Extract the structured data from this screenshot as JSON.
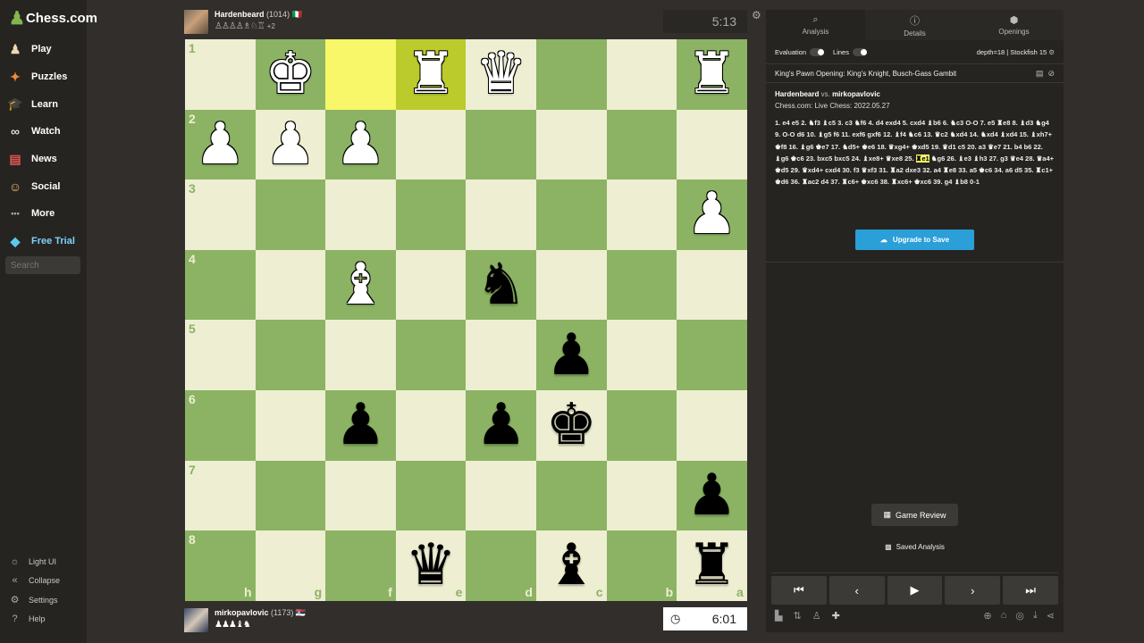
{
  "app": {
    "logo_text": "Chess.com"
  },
  "sidebar": {
    "items": [
      {
        "label": "Play",
        "icon": "pawn-icon"
      },
      {
        "label": "Puzzles",
        "icon": "puzzle-icon"
      },
      {
        "label": "Learn",
        "icon": "graduation-cap-icon"
      },
      {
        "label": "Watch",
        "icon": "binoculars-icon"
      },
      {
        "label": "News",
        "icon": "newspaper-icon"
      },
      {
        "label": "Social",
        "icon": "people-icon"
      },
      {
        "label": "More",
        "icon": "dots-icon"
      },
      {
        "label": "Free Trial",
        "icon": "diamond-icon"
      }
    ],
    "search_placeholder": "Search",
    "bottom_items": [
      {
        "label": "Light UI",
        "icon": "sun-icon"
      },
      {
        "label": "Collapse",
        "icon": "collapse-icon"
      },
      {
        "label": "Settings",
        "icon": "gear-icon"
      },
      {
        "label": "Help",
        "icon": "help-icon"
      }
    ]
  },
  "top_player": {
    "name": "Hardenbeard",
    "rating": "(1014)",
    "flag": "🇮🇹",
    "captured": "♙♙♙♙♗♘♖",
    "advantage": "+2",
    "clock": "5:13"
  },
  "bottom_player": {
    "name": "mirkopavlovic",
    "rating": "(1173)",
    "flag": "🇷🇸",
    "captured": "♟♟♟♝♞",
    "clock": "6:01"
  },
  "board": {
    "ranks": [
      "1",
      "2",
      "3",
      "4",
      "5",
      "6",
      "7",
      "8"
    ],
    "files": [
      "h",
      "g",
      "f",
      "e",
      "d",
      "c",
      "b",
      "a"
    ],
    "pieces": [
      {
        "sq": "g1",
        "glyph": "♚",
        "color": "w"
      },
      {
        "sq": "e1",
        "glyph": "♜",
        "color": "w"
      },
      {
        "sq": "d1",
        "glyph": "♛",
        "color": "w"
      },
      {
        "sq": "a1",
        "glyph": "♜",
        "color": "w"
      },
      {
        "sq": "h2",
        "glyph": "♟",
        "color": "w"
      },
      {
        "sq": "g2",
        "glyph": "♟",
        "color": "w"
      },
      {
        "sq": "f2",
        "glyph": "♟",
        "color": "w"
      },
      {
        "sq": "a3",
        "glyph": "♟",
        "color": "w"
      },
      {
        "sq": "f4",
        "glyph": "♝",
        "color": "w"
      },
      {
        "sq": "d4",
        "glyph": "♞",
        "color": "b"
      },
      {
        "sq": "c5",
        "glyph": "♟",
        "color": "b"
      },
      {
        "sq": "f6",
        "glyph": "♟",
        "color": "b"
      },
      {
        "sq": "d6",
        "glyph": "♟",
        "color": "b"
      },
      {
        "sq": "c6",
        "glyph": "♚",
        "color": "b"
      },
      {
        "sq": "a7",
        "glyph": "♟",
        "color": "b"
      },
      {
        "sq": "e8",
        "glyph": "♛",
        "color": "b"
      },
      {
        "sq": "c8",
        "glyph": "♝",
        "color": "b"
      },
      {
        "sq": "a8",
        "glyph": "♜",
        "color": "b"
      }
    ],
    "highlights": [
      "f1",
      "e1"
    ]
  },
  "panel": {
    "tabs": [
      {
        "label": "Analysis",
        "icon": "magnifier-icon"
      },
      {
        "label": "Details",
        "icon": "info-icon"
      },
      {
        "label": "Openings",
        "icon": "book-icon"
      }
    ],
    "evaluation_label": "Evaluation",
    "lines_label": "Lines",
    "depth": "depth=18 | Stockfish 15",
    "opening": "King's Pawn Opening: King's Knight, Busch-Gass Gambit",
    "white": "Hardenbeard",
    "vs": "vs.",
    "black": "mirkopavlovic",
    "event": "Chess.com: Live Chess: 2022.05.27",
    "moves_before": "1. e4 e5 2. ♞f3 ♝c5 3. c3 ♞f6 4. d4 exd4 5. cxd4 ♝b6 6. ♞c3 O-O 7. e5 ♜e8 8. ♝d3 ♞g4 9. O-O d6 10. ♝g5 f6 11. exf6 gxf6 12. ♝f4 ♞c6 13. ♛c2 ♞xd4 14. ♞xd4 ♝xd4 15. ♝xh7+ ♚f8 16. ♝g6 ♚e7 17. ♞d5+ ♚e6 18. ♛xg4+ ♚xd5 19. ♛d1 c5 20. a3 ♛e7 21. b4 b6 22. ♝g6 ♚c6 23. bxc5 bxc5 24. ♝xe8+ ♛xe8 25. ",
    "moves_current": "♜e1",
    "moves_after": " ♞g6 26. ♝e3 ♝h3 27. g3 ♛e4 28. ♛a4+ ♚d5 29. ♛xd4+ cxd4 30. f3 ♛xf3 31. ♜a2 dxe3 32. a4 ♜e8 33. a5 ♚c6 34. a6 d5 35. ♜c1+ ♚d6 36. ♜ac2 d4 37. ♜c6+ ♚xc6 38. ♜xc6+ ♚xc6 39. g4 ♝b8 0-1",
    "upgrade_label": "Upgrade to Save",
    "game_review_label": "Game Review",
    "saved_analysis_label": "Saved Analysis"
  }
}
